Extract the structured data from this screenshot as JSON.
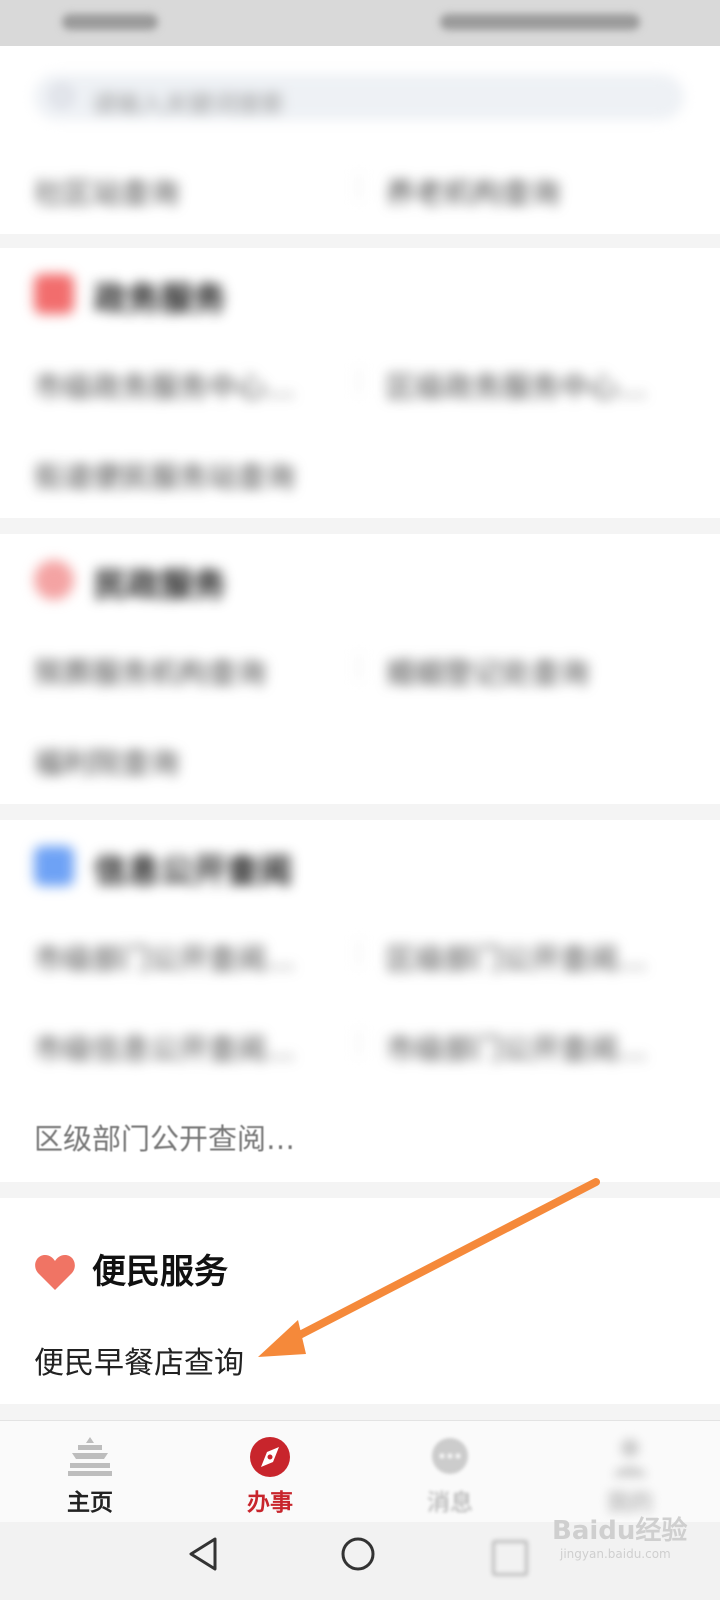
{
  "status": {
    "left": "",
    "right": ""
  },
  "search": {
    "placeholder": "请输入关键词搜索"
  },
  "top_section": {
    "items": [
      "社区站查询",
      "养老机构查询"
    ]
  },
  "sections": [
    {
      "title": "政务服务",
      "icon": "government-icon",
      "color": "#f26d6d",
      "items": [
        "市级政务服务中心…",
        "区级政务服务中心…",
        "街道便民服务站查询"
      ]
    },
    {
      "title": "民政服务",
      "icon": "civil-affairs-icon",
      "color": "#f4a3a3",
      "items": [
        "殡葬服务机构查询",
        "婚姻登记处查询",
        "福利院查询"
      ]
    },
    {
      "title": "信息公开查阅",
      "icon": "info-public-icon",
      "color": "#6ea2f5",
      "items": [
        "市级部门公开查阅…",
        "区级部门公开查阅…",
        "市级信息公开查阅…",
        "市级部门公开查阅…",
        "区级部门公开查阅…"
      ]
    }
  ],
  "convenience": {
    "title": "便民服务",
    "icon": "heart-icon",
    "item": "便民早餐店查询",
    "color": "#f07464"
  },
  "tabbar": {
    "tabs": [
      {
        "label": "主页",
        "icon": "temple-icon",
        "active": false
      },
      {
        "label": "办事",
        "icon": "compass-icon",
        "active": true
      },
      {
        "label": "消息",
        "icon": "chat-icon",
        "active": false
      },
      {
        "label": "我的",
        "icon": "person-icon",
        "active": false
      }
    ],
    "active_color": "#c8252c"
  },
  "navbar": {
    "back": "back-icon",
    "home": "home-icon",
    "recent": "recent-icon"
  },
  "watermark": {
    "brand": "Baidu经验",
    "url": "jingyan.baidu.com"
  },
  "annotation": {
    "arrow_color": "#f5893a"
  }
}
